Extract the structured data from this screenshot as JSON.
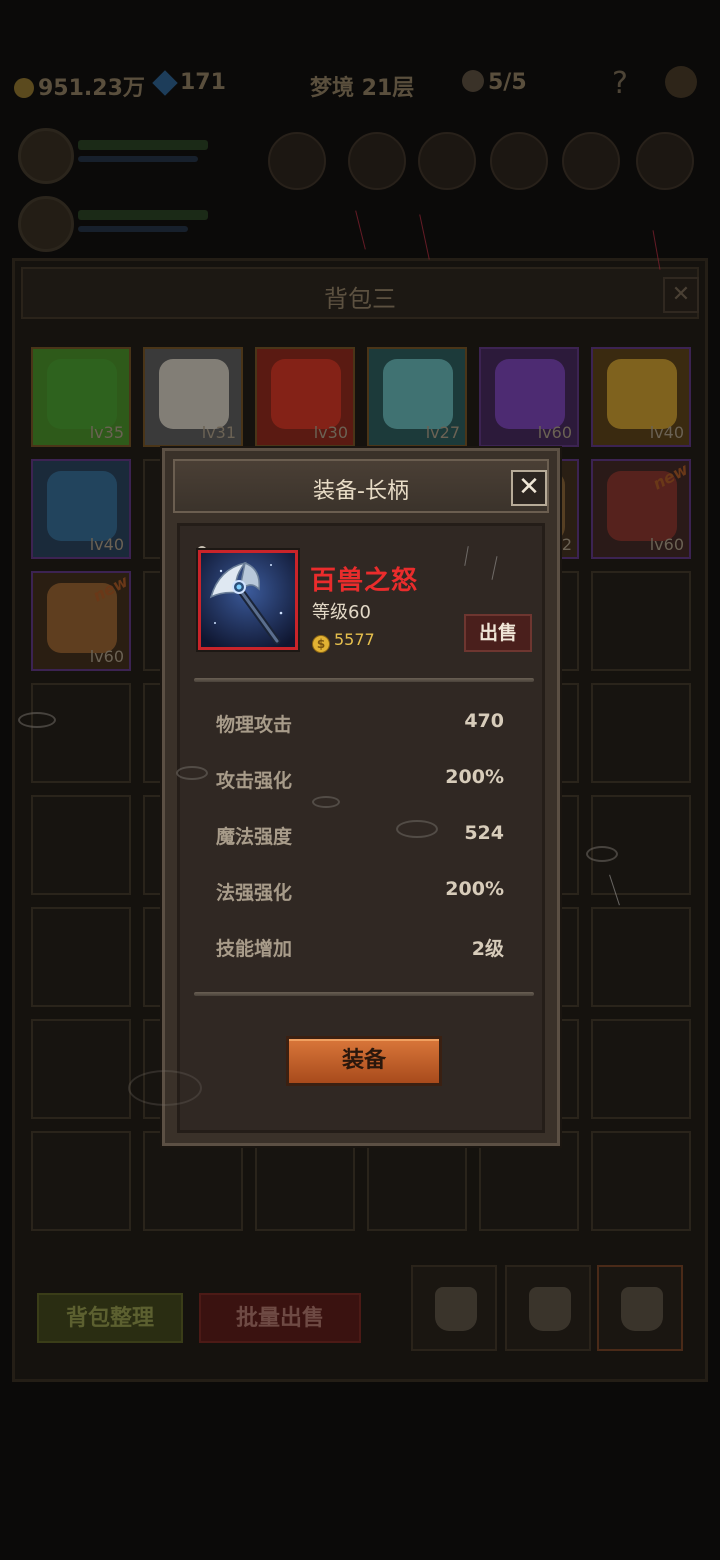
{
  "hud": {
    "gold": "951.23万",
    "gems": "171",
    "dungeon": "梦境 21层",
    "keys": "5/5",
    "help": "?"
  },
  "backpack": {
    "title": "背包三",
    "close": "✕",
    "slots": [
      {
        "lv": "lv35",
        "color": "#2e5a1a",
        "border": "#4a3518",
        "item": "#2f6a22"
      },
      {
        "lv": "lv31",
        "color": "#3a3a3a",
        "border": "#4a3518",
        "item": "#bdb6a8"
      },
      {
        "lv": "lv30",
        "color": "#5a1a12",
        "border": "#4a3518",
        "item": "#a82a1c"
      },
      {
        "lv": "lv27",
        "color": "#1c3a3a",
        "border": "#4a3518",
        "item": "#5fa0a0"
      },
      {
        "lv": "lv60",
        "color": "#2c1a3a",
        "border": "#3c2352",
        "item": "#6a3aa0"
      },
      {
        "lv": "lv40",
        "color": "#3a2a10",
        "border": "#3c2352",
        "item": "#b8902a"
      },
      {
        "lv": "lv40",
        "color": "#1a2a3a",
        "border": "#3c2352",
        "item": "#2a5a7a"
      },
      {
        "lv": "",
        "color": "",
        "border": "",
        "item": ""
      },
      {
        "lv": "",
        "color": "",
        "border": "",
        "item": ""
      },
      {
        "lv": "",
        "color": "",
        "border": "",
        "item": ""
      },
      {
        "lv": "2",
        "color": "#2a1f14",
        "border": "#3c2352",
        "item": "#7a5a30"
      },
      {
        "lv": "lv60",
        "color": "#2a1a18",
        "border": "#3c2352",
        "item": "#7a2a22",
        "new": "new"
      },
      {
        "lv": "lv60",
        "color": "#2a1e12",
        "border": "#3c2352",
        "item": "#8a5a2a",
        "new": "new"
      }
    ],
    "sort_button": "背包整理",
    "bulk_sell_button": "批量出售"
  },
  "modal": {
    "title": "装备-长柄",
    "close": "✕",
    "item_name": "百兽之怒",
    "level": "等级60",
    "coin_symbol": "$",
    "price": "5577",
    "sell": "出售",
    "stats": [
      {
        "name": "物理攻击",
        "value": "470"
      },
      {
        "name": "攻击强化",
        "value": "200%"
      },
      {
        "name": "魔法强度",
        "value": "524"
      },
      {
        "name": "法强强化",
        "value": "200%"
      },
      {
        "name": "技能增加",
        "value": "2级"
      }
    ],
    "equip": "装备"
  },
  "colors": {
    "item_name": "#ea2c2c",
    "rarity_frame": "#c9242a",
    "equip_button": "#c4622a",
    "coin": "#e2b233"
  }
}
